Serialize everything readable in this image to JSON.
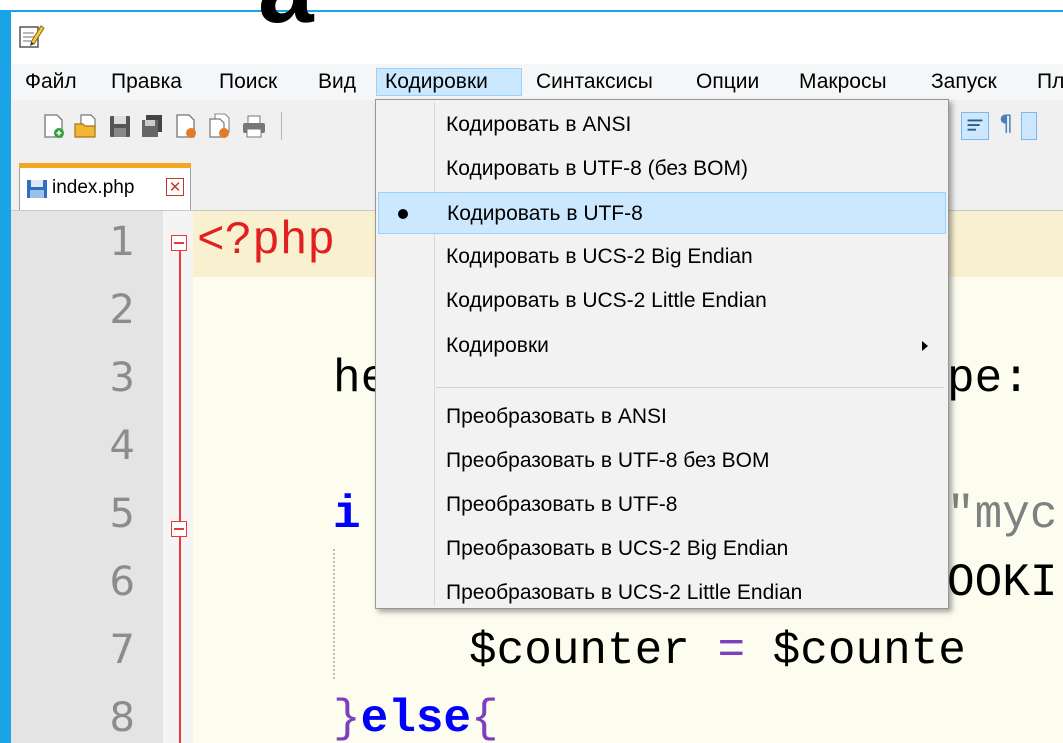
{
  "decor": {
    "big_letter": "a"
  },
  "menubar": {
    "items": [
      "Файл",
      "Правка",
      "Поиск",
      "Вид",
      "Кодировки",
      "Синтаксисы",
      "Опции",
      "Макросы",
      "Запуск",
      "Пл"
    ],
    "active_index": 4
  },
  "toolbar": {
    "icons": [
      "new-file-icon",
      "open-file-icon",
      "save-icon",
      "save-all-icon",
      "close-file-icon",
      "close-all-icon",
      "print-icon"
    ],
    "right_icons": [
      "word-wrap-icon",
      "pilcrow-icon"
    ]
  },
  "tab": {
    "label": "index.php",
    "close_glyph": "✕",
    "accent_color": "#f5a623"
  },
  "editor": {
    "line_numbers": [
      "1",
      "2",
      "3",
      "4",
      "5",
      "6",
      "7",
      "8"
    ],
    "visible_code": {
      "l1": "<?php",
      "l3_left": "he",
      "l3_right": "pe:",
      "l5_left": "i",
      "l5_right": "\"myc",
      "l6_right": "OOKI",
      "l7_var": "$counter",
      "l7_op": " = ",
      "l7_rhs": "$counte",
      "l8_brace": "}",
      "l8_kw": "else",
      "l8_open": "{"
    },
    "colors": {
      "php_tag": "#e02020",
      "keyword": "#0000ff",
      "operator": "#7b3fbf",
      "variable": "#000000"
    }
  },
  "dropdown": {
    "items": [
      "Кодировать в ANSI",
      "Кодировать в UTF-8 (без BOM)",
      "Кодировать в UTF-8",
      "Кодировать в UCS-2 Big Endian",
      "Кодировать в UCS-2 Little Endian",
      "Кодировки",
      "Преобразовать в ANSI",
      "Преобразовать в UTF-8 без BOM",
      "Преобразовать в UTF-8",
      "Преобразовать в UCS-2 Big Endian",
      "Преобразовать в UCS-2 Little Endian"
    ],
    "selected_index": 2,
    "submenu_index": 5
  }
}
